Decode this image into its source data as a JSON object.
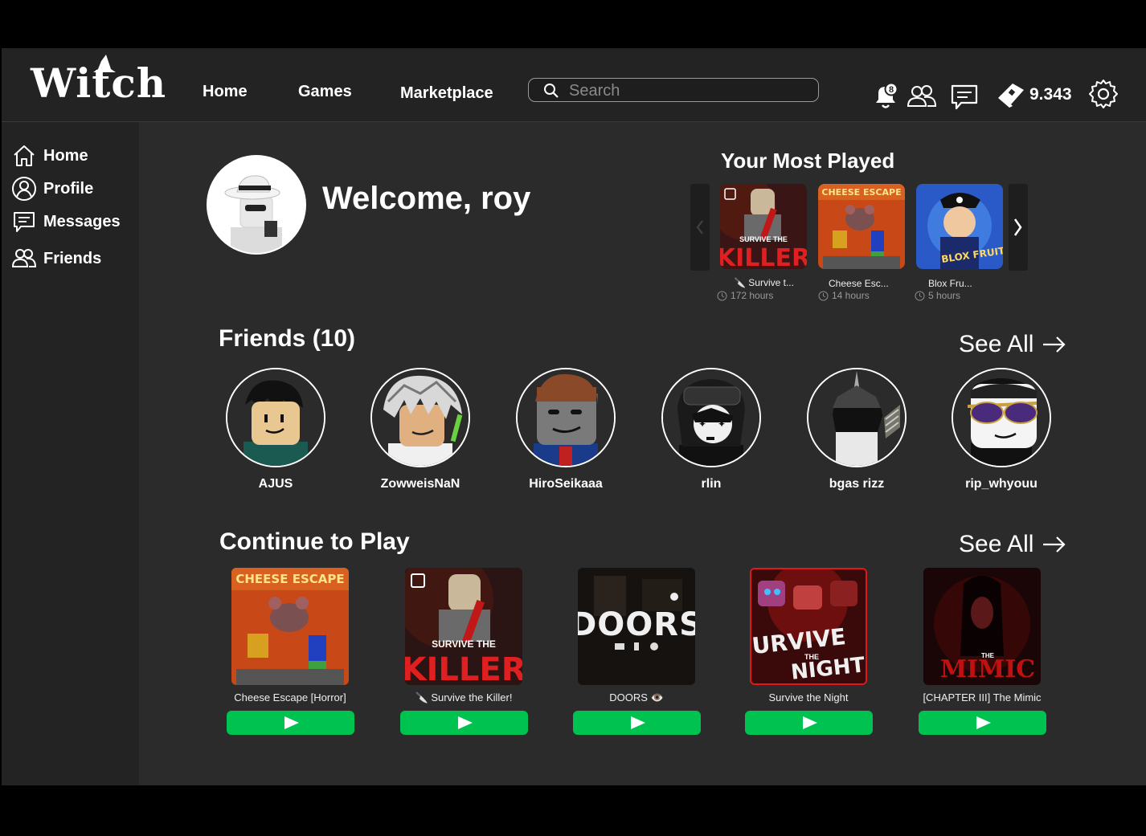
{
  "app": {
    "logo": "Witch"
  },
  "topnav": {
    "home": "Home",
    "games": "Games",
    "marketplace": "Marketplace"
  },
  "search": {
    "placeholder": "Search"
  },
  "topbar": {
    "notification_count": "8",
    "robux": "9.343"
  },
  "sidebar": {
    "items": [
      {
        "label": "Home",
        "icon": "home-icon"
      },
      {
        "label": "Profile",
        "icon": "profile-icon"
      },
      {
        "label": "Messages",
        "icon": "messages-icon"
      },
      {
        "label": "Friends",
        "icon": "friends-icon"
      }
    ]
  },
  "welcome": {
    "text": "Welcome, roy"
  },
  "most_played": {
    "title": "Your Most Played",
    "items": [
      {
        "name": "🔪 Survive t...",
        "hours": "172 hours"
      },
      {
        "name": "Cheese Esc...",
        "hours": "14 hours"
      },
      {
        "name": "Blox Fru...",
        "hours": "5 hours"
      }
    ]
  },
  "friends": {
    "title": "Friends (10)",
    "see_all": "See All",
    "items": [
      {
        "name": "AJUS"
      },
      {
        "name": "ZowweisNaN"
      },
      {
        "name": "HiroSeikaaa"
      },
      {
        "name": "rlin"
      },
      {
        "name": "bgas rizz"
      },
      {
        "name": "rip_whyouu"
      }
    ]
  },
  "continue": {
    "title": "Continue to Play",
    "see_all": "See All",
    "games": [
      {
        "name": "Cheese Escape [Horror]",
        "thumb_text": "CHEESE ESCAPE"
      },
      {
        "name": "🔪 Survive the Killer!",
        "thumb_text_top": "SURVIVE THE",
        "thumb_text": "KILLER"
      },
      {
        "name": "DOORS 👁️",
        "thumb_text": "DOORS"
      },
      {
        "name": "Survive the Night",
        "thumb_text_top": "SURVIVE",
        "thumb_text_sub": "THE",
        "thumb_text": "NIGHT"
      },
      {
        "name": "[CHAPTER III] The Mimic",
        "thumb_text_sub": "THE",
        "thumb_text": "MIMIC"
      }
    ]
  },
  "thumbs": {
    "mp_killer_top": "SURVIVE THE",
    "mp_killer": "KILLER",
    "mp_cheese": "CHEESE ESCAPE",
    "mp_blox": "BLOX FRUITS"
  },
  "colors": {
    "play": "#00c250",
    "bg": "#2b2b2b",
    "panel": "#232323"
  }
}
